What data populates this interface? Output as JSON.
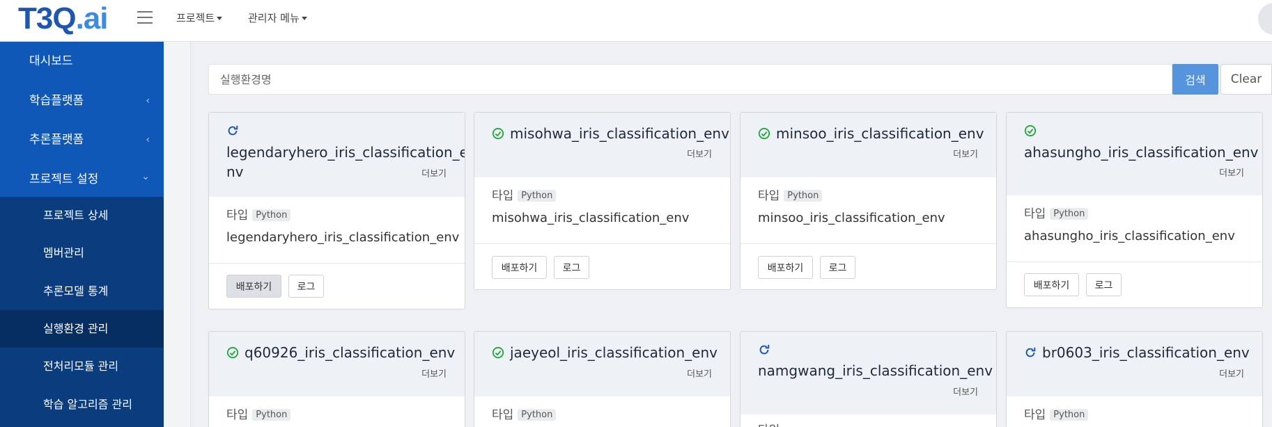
{
  "brand": {
    "logo_main": "T3Q",
    "logo_suffix": ".ai"
  },
  "topnav": {
    "menu1": "프로젝트",
    "menu2": "관리자 메뉴"
  },
  "sidebar": {
    "items": [
      {
        "label": "대시보드"
      },
      {
        "label": "학습플랫폼",
        "chevron": "‹"
      },
      {
        "label": "추론플랫폼",
        "chevron": "‹"
      },
      {
        "label": "프로젝트 설정",
        "chevron": "⌄"
      }
    ],
    "sub_items": [
      {
        "label": "프로젝트 상세"
      },
      {
        "label": "멤버관리"
      },
      {
        "label": "추론모델 통계"
      },
      {
        "label": "실행환경 관리",
        "active": true
      },
      {
        "label": "전처리모듈 관리"
      },
      {
        "label": "학습 알고리즘 관리"
      }
    ]
  },
  "search": {
    "placeholder": "실행환경명",
    "search_label": "검색",
    "clear_label": "Clear"
  },
  "cards": [
    {
      "status": "refresh",
      "title": "legendaryhero_iris_classification_env",
      "title_l1": "legendaryhero_iris_classification_e",
      "title_l2": "nv",
      "more": "더보기",
      "type_label": "타입",
      "badge": "Python",
      "env_name": "legendaryhero_iris_classification_env",
      "deploy": "배포하기",
      "log": "로그"
    },
    {
      "status": "ok",
      "title": "misohwa_iris_classification_env",
      "more": "더보기",
      "type_label": "타입",
      "badge": "Python",
      "env_name": "misohwa_iris_classification_env",
      "deploy": "배포하기",
      "log": "로그"
    },
    {
      "status": "ok",
      "title": "minsoo_iris_classification_env",
      "more": "더보기",
      "type_label": "타입",
      "badge": "Python",
      "env_name": "minsoo_iris_classification_env",
      "deploy": "배포하기",
      "log": "로그"
    },
    {
      "status": "ok",
      "title": "ahasungho_iris_classification_env",
      "more": "더보기",
      "type_label": "타입",
      "badge": "Python",
      "env_name": "ahasungho_iris_classification_env",
      "deploy": "배포하기",
      "log": "로그"
    },
    {
      "status": "ok",
      "title": "q60926_iris_classification_env",
      "more": "더보기",
      "type_label": "타입",
      "badge": "Python"
    },
    {
      "status": "ok",
      "title": "jaeyeol_iris_classification_env",
      "more": "더보기",
      "type_label": "타입",
      "badge": "Python"
    },
    {
      "status": "refresh",
      "title": "namgwang_iris_classification_env",
      "more": "더보기",
      "type_label": "타입"
    },
    {
      "status": "refresh",
      "title": "br0603_iris_classification_env",
      "more": "더보기",
      "type_label": "타입",
      "badge": "Python"
    }
  ],
  "colors": {
    "sidebar": "#1058b8",
    "sidebar_sub": "#0a3c7e",
    "accent": "#5794de",
    "ok": "#1fa63a",
    "refresh": "#1f57b0"
  }
}
